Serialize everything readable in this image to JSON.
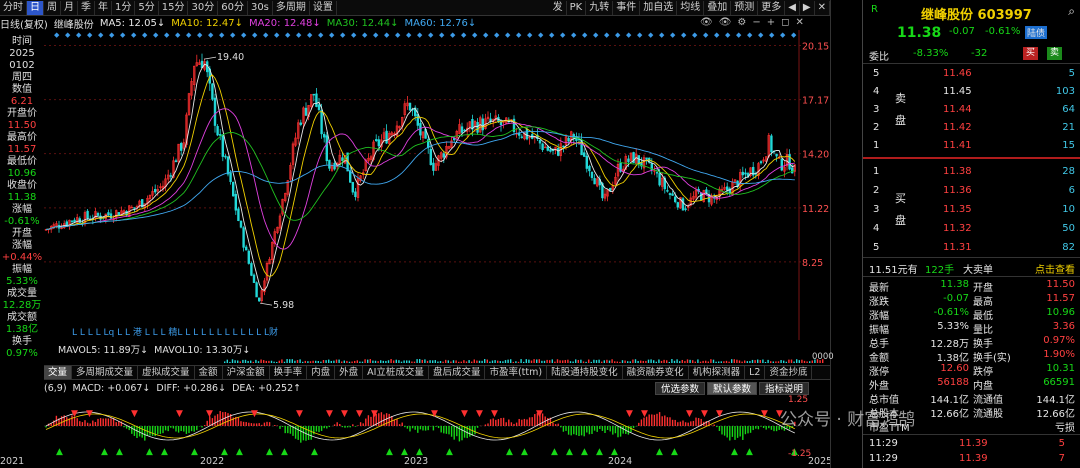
{
  "toolbar": {
    "left": [
      "分时",
      "日",
      "周",
      "月",
      "季",
      "年",
      "1分",
      "5分",
      "15分",
      "30分",
      "60分",
      "30s",
      "多周期",
      "设置"
    ],
    "active_index": 1,
    "right": [
      "发",
      "PK",
      "九转",
      "事件",
      "加自选",
      "均线",
      "叠加",
      "预测",
      "更多"
    ],
    "right_icons": [
      "◀",
      "▶",
      "✕"
    ]
  },
  "ma": {
    "label": "日线(复权)",
    "stock": "继峰股份",
    "ma5": "MA5: 12.05↓",
    "ma10": "MA10: 12.47↓",
    "ma20": "MA20: 12.48↓",
    "ma30": "MA30: 12.44↓",
    "ma60": "MA60: 12.76↓"
  },
  "info_panel": [
    {
      "t": "时间",
      "c": "wh"
    },
    {
      "t": "2025",
      "c": "wh"
    },
    {
      "t": "0102",
      "c": "wh"
    },
    {
      "t": "周四",
      "c": "wh"
    },
    {
      "t": "数值",
      "c": "wh"
    },
    {
      "t": "6.21",
      "c": "up"
    },
    {
      "t": "开盘价",
      "c": "wh"
    },
    {
      "t": "11.50",
      "c": "up"
    },
    {
      "t": "最高价",
      "c": "wh"
    },
    {
      "t": "11.57",
      "c": "up"
    },
    {
      "t": "最低价",
      "c": "wh"
    },
    {
      "t": "10.96",
      "c": "dn"
    },
    {
      "t": "收盘价",
      "c": "wh"
    },
    {
      "t": "11.38",
      "c": "dn"
    },
    {
      "t": "涨幅",
      "c": "wh"
    },
    {
      "t": "-0.61%",
      "c": "dn"
    },
    {
      "t": "开盘",
      "c": "wh"
    },
    {
      "t": "涨幅",
      "c": "wh"
    },
    {
      "t": "+0.44%",
      "c": "up"
    },
    {
      "t": "振幅",
      "c": "wh"
    },
    {
      "t": "5.33%",
      "c": "dn"
    },
    {
      "t": "成交量",
      "c": "wh"
    },
    {
      "t": "12.28万",
      "c": "dn"
    },
    {
      "t": "成交额",
      "c": "wh"
    },
    {
      "t": "1.38亿",
      "c": "dn"
    },
    {
      "t": "换手",
      "c": "wh"
    },
    {
      "t": "0.97%",
      "c": "dn"
    }
  ],
  "chart": {
    "price_labels": [
      "20.15",
      "17.17",
      "14.20",
      "11.22",
      "8.25"
    ],
    "high_mark": "19.40",
    "low_mark": "5.98",
    "event_letters": "L L L  L Lq L  L   港 L   L  L 精L  L L  L   L   L  L  L  L  L  L   L财",
    "vol_label": "MAVOL5: 11.89万↓  MAVOL10: 13.30万↓",
    "vol_axis": "0000",
    "macd_label": "MACD: +0.067↓  DIFF: +0.286↓  DEA: +0.252↑",
    "macd_prefix": "(6,9)",
    "macd_axis_top": "1.25",
    "macd_axis_bottom": "-1.25",
    "macd_buttons": [
      "优选参数",
      "默认参数",
      "指标说明"
    ]
  },
  "indicator_tabs": [
    "交量",
    "多周期成交量",
    "虚拟成交量",
    "金额",
    "沪深金额",
    "换手率",
    "内盘",
    "外盘",
    "AI立桩成交量",
    "盘后成交量",
    "市盈率(ttm)",
    "陆股通持股变化",
    "融资融券变化",
    "机构探测器",
    "L2",
    "资金抄底"
  ],
  "years": [
    "2021",
    "2022",
    "2023",
    "2024",
    "2025"
  ],
  "quote": {
    "flag": "R",
    "name": "继峰股份",
    "code": "603997",
    "price": "11.38",
    "change": "-0.07",
    "pct": "-0.61%",
    "tag": "陆债",
    "webi_label": "委比",
    "webi": "-8.33%",
    "webi_diff": "-32",
    "buy_btn": "买",
    "sell_btn": "卖",
    "sell_side_label": "卖盘",
    "buy_side_label": "买盘",
    "asks": [
      {
        "n": "5",
        "p": "11.46",
        "v": "5"
      },
      {
        "n": "4",
        "p": "11.45",
        "v": "103"
      },
      {
        "n": "3",
        "p": "11.44",
        "v": "64"
      },
      {
        "n": "2",
        "p": "11.42",
        "v": "21"
      },
      {
        "n": "1",
        "p": "11.41",
        "v": "15"
      }
    ],
    "bids": [
      {
        "n": "1",
        "p": "11.38",
        "v": "28"
      },
      {
        "n": "2",
        "p": "11.36",
        "v": "6"
      },
      {
        "n": "3",
        "p": "11.35",
        "v": "10"
      },
      {
        "n": "4",
        "p": "11.32",
        "v": "50"
      },
      {
        "n": "5",
        "p": "11.31",
        "v": "82"
      }
    ],
    "big_order": {
      "a": "11.51元有",
      "b": "122手",
      "c": "大卖单",
      "d": "点击查看"
    },
    "stats": [
      {
        "l": "最新",
        "v": "11.38",
        "vc": "grn",
        "l2": "开盘",
        "v2": "11.50",
        "v2c": "red"
      },
      {
        "l": "涨跌",
        "v": "-0.07",
        "vc": "grn",
        "l2": "最高",
        "v2": "11.57",
        "v2c": "red"
      },
      {
        "l": "涨幅",
        "v": "-0.61%",
        "vc": "grn",
        "l2": "最低",
        "v2": "10.96",
        "v2c": "grn"
      },
      {
        "l": "振幅",
        "v": "5.33%",
        "vc": "wht",
        "l2": "量比",
        "v2": "3.36",
        "v2c": "red"
      },
      {
        "l": "总手",
        "v": "12.28万",
        "vc": "wht",
        "l2": "换手",
        "v2": "0.97%",
        "v2c": "red"
      },
      {
        "l": "金额",
        "v": "1.38亿",
        "vc": "wht",
        "l2": "换手(实)",
        "v2": "1.90%",
        "v2c": "red"
      },
      {
        "l": "涨停",
        "v": "12.60",
        "vc": "red",
        "l2": "跌停",
        "v2": "10.31",
        "v2c": "grn"
      },
      {
        "l": "外盘",
        "v": "56188",
        "vc": "red",
        "l2": "内盘",
        "v2": "66591",
        "v2c": "grn"
      },
      {
        "l": "总市值",
        "v": "144.1亿",
        "vc": "wht",
        "l2": "流通值",
        "v2": "144.1亿",
        "v2c": "wht"
      },
      {
        "l": "总股本",
        "v": "12.66亿",
        "vc": "wht",
        "l2": "流通股",
        "v2": "12.66亿",
        "v2c": "wht"
      },
      {
        "l": "市盈TTM",
        "v": "",
        "vc": "wht",
        "l2": "",
        "v2": "亏损",
        "v2c": "wht"
      }
    ],
    "ticks": [
      {
        "t": "11:29",
        "p": "11.39",
        "v": "5"
      },
      {
        "t": "11:29",
        "p": "11.39",
        "v": "7"
      }
    ]
  },
  "watermark": "公众号 · 财富鸿鹄",
  "colors": {
    "up": "#ff4040",
    "down": "#17d817",
    "ma5": "#e8e8e8",
    "ma10": "#f0d000",
    "ma20": "#e040e0",
    "ma30": "#20c020",
    "ma60": "#40a8f0"
  }
}
